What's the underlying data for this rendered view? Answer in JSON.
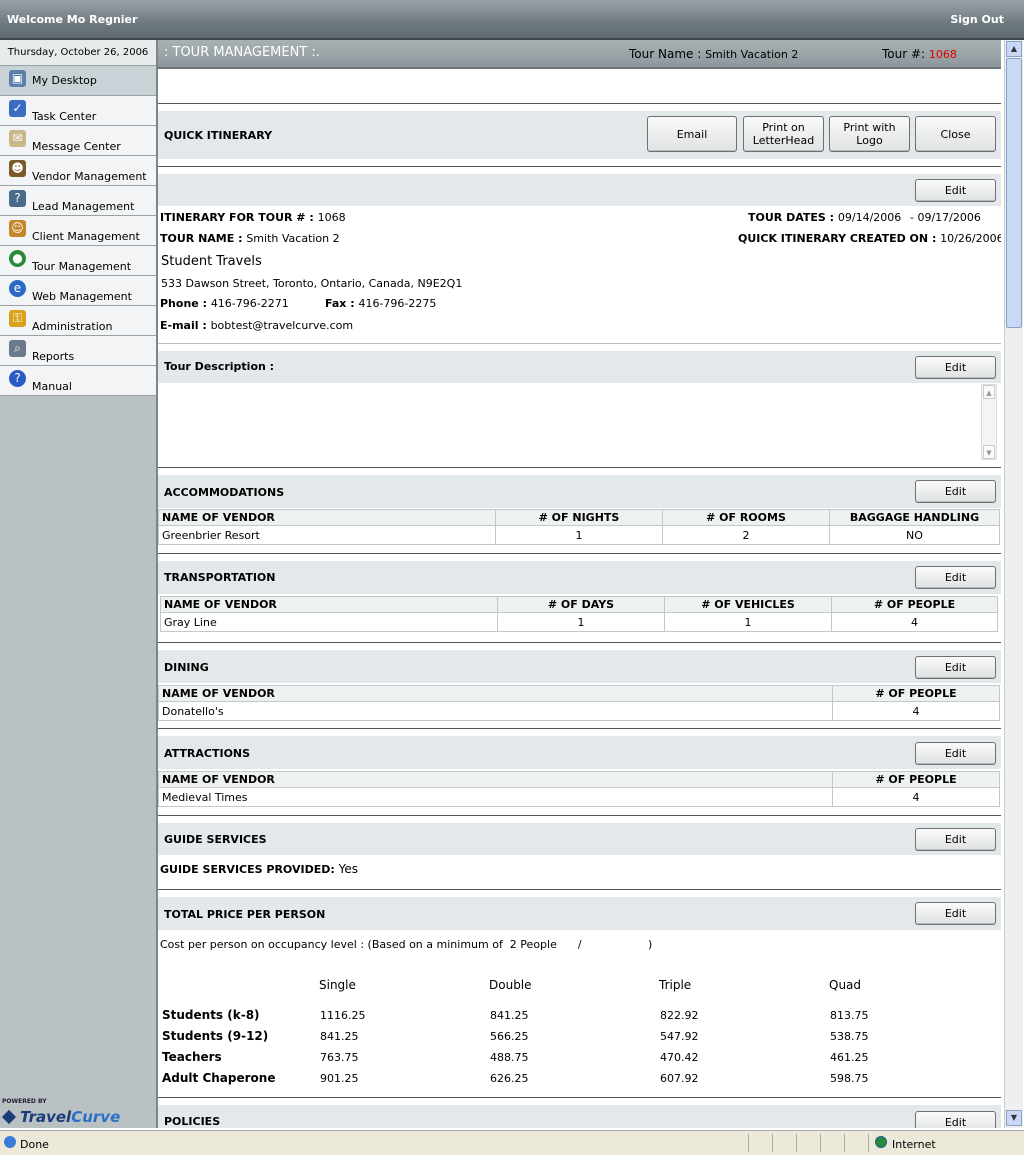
{
  "header": {
    "welcome": "Welcome Mo Regnier",
    "signout": "Sign Out"
  },
  "sidebar": {
    "date": "Thursday, October 26, 2006",
    "items": [
      {
        "label": "My Desktop",
        "icon": "desktop-icon",
        "color": "#5b7fa8"
      },
      {
        "label": "Task Center",
        "icon": "task-icon",
        "color": "#3a6cc4"
      },
      {
        "label": "Message Center",
        "icon": "envelope-icon",
        "color": "#c9b98a"
      },
      {
        "label": "Vendor Management",
        "icon": "vendor-icon",
        "color": "#7a5a2a"
      },
      {
        "label": "Lead Management",
        "icon": "lead-icon",
        "color": "#4a6a8a"
      },
      {
        "label": "Client Management",
        "icon": "client-icon",
        "color": "#c4882a"
      },
      {
        "label": "Tour Management",
        "icon": "globe-icon",
        "color": "#2a8a3a"
      },
      {
        "label": "Web Management",
        "icon": "ie-icon",
        "color": "#2a6ac4"
      },
      {
        "label": "Administration",
        "icon": "lock-icon",
        "color": "#d9a21a"
      },
      {
        "label": "Reports",
        "icon": "magnifier-icon",
        "color": "#6a7a8a"
      },
      {
        "label": "Manual",
        "icon": "help-icon",
        "color": "#2a5ac4"
      }
    ],
    "powered": "POWERED BY",
    "logo_a": "Travel",
    "logo_b": "Curve"
  },
  "titlebar": {
    "section": ": TOUR MANAGEMENT :.",
    "tour_name_label": "Tour Name : ",
    "tour_name": "Smith Vacation 2",
    "tour_num_label": "Tour #: ",
    "tour_num": "1068"
  },
  "quick": {
    "title": "QUICK ITINERARY",
    "email": "Email",
    "print_letterhead_1": "Print on",
    "print_letterhead_2": "LetterHead",
    "print_logo_1": "Print with",
    "print_logo_2": "Logo",
    "close": "Close"
  },
  "edit_label": "Edit",
  "itinerary": {
    "for_label": "ITINERARY FOR TOUR # : ",
    "for_value": "1068",
    "name_label": "TOUR NAME : ",
    "name_value": "Smith Vacation 2",
    "company": "Student Travels",
    "address": "533 Dawson Street, Toronto, Ontario, Canada, N9E2Q1",
    "phone_label": "Phone : ",
    "phone": "416-796-2271",
    "fax_label": "Fax : ",
    "fax": "416-796-2275",
    "email_label": "E-mail : ",
    "email": "bobtest@travelcurve.com",
    "dates_label": "TOUR DATES : ",
    "date_from": "09/14/2006",
    "date_to": "- 09/17/2006",
    "created_label": "QUICK ITINERARY CREATED ON : ",
    "created": "10/26/2006"
  },
  "description": {
    "title": "Tour Description :"
  },
  "accommodations": {
    "title": "ACCOMMODATIONS",
    "headers": [
      "NAME OF VENDOR",
      "# OF NIGHTS",
      "# OF ROOMS",
      "BAGGAGE HANDLING"
    ],
    "row": [
      "Greenbrier Resort",
      "1",
      "2",
      "NO"
    ]
  },
  "transportation": {
    "title": "TRANSPORTATION",
    "headers": [
      "NAME OF VENDOR",
      "# OF DAYS",
      "# OF VEHICLES",
      "# OF PEOPLE"
    ],
    "row": [
      "Gray Line",
      "1",
      "1",
      "4"
    ]
  },
  "dining": {
    "title": "DINING",
    "headers": [
      "NAME OF VENDOR",
      "# OF PEOPLE"
    ],
    "row": [
      "Donatello's",
      "4"
    ]
  },
  "attractions": {
    "title": "ATTRACTIONS",
    "headers": [
      "NAME OF VENDOR",
      "# OF PEOPLE"
    ],
    "row": [
      "Medieval Times",
      "4"
    ]
  },
  "guide": {
    "title": "GUIDE SERVICES",
    "label": "GUIDE SERVICES PROVIDED: ",
    "value": "Yes"
  },
  "price": {
    "title": "TOTAL PRICE PER PERSON",
    "note": "Cost per person on occupancy level : (Based on a minimum of  2 People      /                   )",
    "headers": [
      "Single",
      "Double",
      "Triple",
      "Quad"
    ],
    "rows": [
      {
        "label": "Students (k-8)",
        "values": [
          "1116.25",
          "841.25",
          "822.92",
          "813.75"
        ]
      },
      {
        "label": "Students (9-12)",
        "values": [
          "841.25",
          "566.25",
          "547.92",
          "538.75"
        ]
      },
      {
        "label": "Teachers",
        "values": [
          "763.75",
          "488.75",
          "470.42",
          "461.25"
        ]
      },
      {
        "label": "Adult Chaperone",
        "values": [
          "901.25",
          "626.25",
          "607.92",
          "598.75"
        ]
      }
    ]
  },
  "policies": {
    "title": "POLICIES"
  },
  "status": {
    "done": "Done",
    "zone": "Internet"
  }
}
